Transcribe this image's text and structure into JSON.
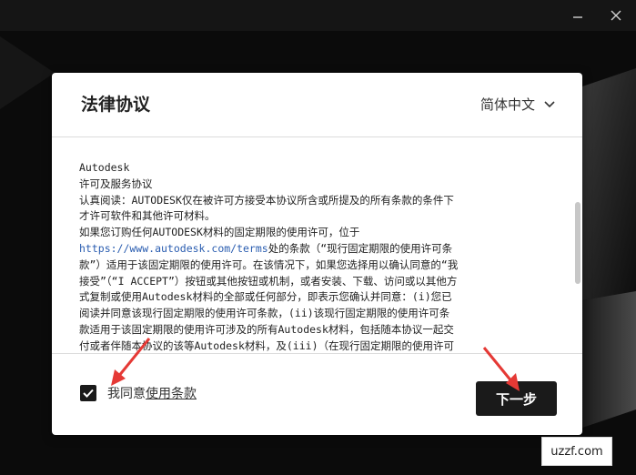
{
  "window": {
    "minimize_icon": "minimize-icon",
    "close_icon": "close-icon"
  },
  "dialog": {
    "title": "法律协议",
    "language": "简体中文",
    "legal_lines": [
      "Autodesk",
      "许可及服务协议",
      "认真阅读：AUTODESK仅在被许可方接受本协议所含或所提及的所有条款的条件下",
      "才许可软件和其他许可材料。",
      "如果您订购任何AUTODESK材料的固定期限的使用许可，位于",
      "处的条款（“现行固定期限的使用许可条",
      "款”）适用于该固定期限的使用许可。在该情况下，如果您选择用以确认同意的“我",
      "接受”（“I ACCEPT”）按钮或其他按钮或机制，或者安装、下载、访问或以其他方",
      "式复制或使用Autodesk材料的全部或任何部分，即表示您确认并同意：(i)您已",
      "阅读并同意该现行固定期限的使用许可条款，(ii)该现行固定期限的使用许可条",
      "款适用于该固定期限的使用许可涉及的所有Autodesk材料，包括随本协议一起交",
      "付或者伴随本协议的该等Autodesk材料，及(iii)（在现行固定期限的使用许可"
    ],
    "terms_url": "https://www.autodesk.com/terms",
    "agree_prefix": "我同意",
    "agree_link": "使用条款",
    "agree_checked": true,
    "next_button": "下一步"
  },
  "watermark": "uzzf.com",
  "colors": {
    "background": "#0b0b0b",
    "dialog": "#ffffff",
    "button": "#1a1a1a",
    "link": "#2a5db0",
    "annotation_arrow": "#e53935"
  }
}
